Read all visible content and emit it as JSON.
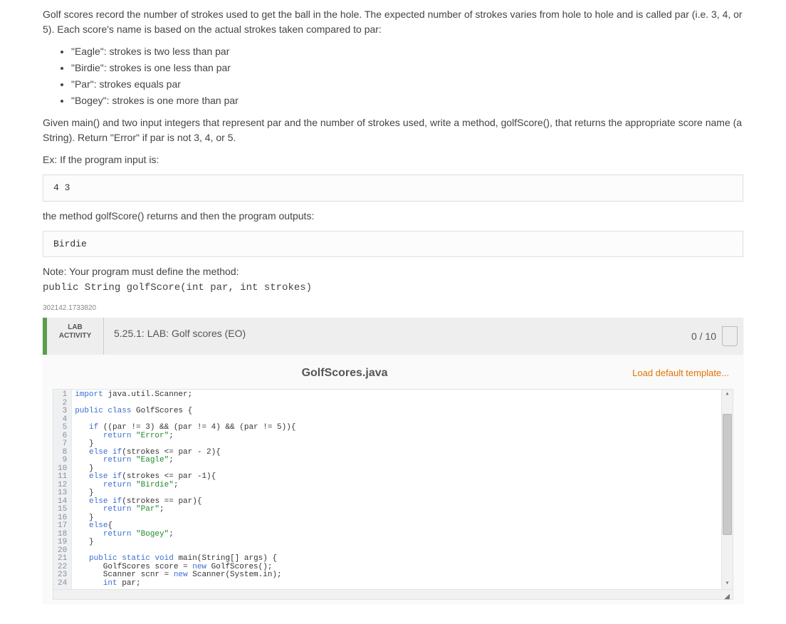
{
  "intro": {
    "paragraph1": "Golf scores record the number of strokes used to get the ball in the hole. The expected number of strokes varies from hole to hole and is called par (i.e. 3, 4, or 5). Each score's name is based on the actual strokes taken compared to par:",
    "bullets": [
      "\"Eagle\": strokes is two less than par",
      "\"Birdie\": strokes is one less than par",
      "\"Par\": strokes equals par",
      "\"Bogey\": strokes is one more than par"
    ],
    "paragraph2": "Given main() and two input integers that represent par and the number of strokes used, write a method, golfScore(), that returns the appropriate score name (a String). Return \"Error\" if par is not 3, 4, or 5.",
    "example_label": "Ex: If the program input is:",
    "example_input": "4 3",
    "output_label": "the method golfScore() returns and then the program outputs:",
    "example_output": "Birdie",
    "note_label": "Note: Your program must define the method:",
    "method_sig": "public String golfScore(int par, int strokes)",
    "ref_id": "302142.1733820"
  },
  "activity": {
    "label": "LAB\nACTIVITY",
    "title": "5.25.1: LAB: Golf scores (EO)",
    "score": "0 / 10"
  },
  "editor": {
    "filename": "GolfScores.java",
    "load_template": "Load default template...",
    "code_lines": [
      [
        [
          "kw",
          "import"
        ],
        [
          "",
          " java.util.Scanner;"
        ]
      ],
      [],
      [
        [
          "kw",
          "public"
        ],
        [
          "",
          " "
        ],
        [
          "kw",
          "class"
        ],
        [
          "",
          " GolfScores {"
        ]
      ],
      [],
      [
        [
          "",
          "   "
        ],
        [
          "kw",
          "if"
        ],
        [
          "",
          " ((par != 3) && (par != 4) && (par != 5)){"
        ]
      ],
      [
        [
          "",
          "      "
        ],
        [
          "kw",
          "return"
        ],
        [
          "",
          " "
        ],
        [
          "str",
          "\"Error\""
        ],
        [
          "",
          ";"
        ]
      ],
      [
        [
          "",
          "   }"
        ]
      ],
      [
        [
          "",
          "   "
        ],
        [
          "kw",
          "else"
        ],
        [
          "",
          " "
        ],
        [
          "kw",
          "if"
        ],
        [
          "",
          "(strokes <= par - 2){"
        ]
      ],
      [
        [
          "",
          "      "
        ],
        [
          "kw",
          "return"
        ],
        [
          "",
          " "
        ],
        [
          "str",
          "\"Eagle\""
        ],
        [
          "",
          ";"
        ]
      ],
      [
        [
          "",
          "   }"
        ]
      ],
      [
        [
          "",
          "   "
        ],
        [
          "kw",
          "else"
        ],
        [
          "",
          " "
        ],
        [
          "kw",
          "if"
        ],
        [
          "",
          "(strokes <= par -1){"
        ]
      ],
      [
        [
          "",
          "      "
        ],
        [
          "kw",
          "return"
        ],
        [
          "",
          " "
        ],
        [
          "str",
          "\"Birdie\""
        ],
        [
          "",
          ";"
        ]
      ],
      [
        [
          "",
          "   }"
        ]
      ],
      [
        [
          "",
          "   "
        ],
        [
          "kw",
          "else"
        ],
        [
          "",
          " "
        ],
        [
          "kw",
          "if"
        ],
        [
          "",
          "(strokes == par){"
        ]
      ],
      [
        [
          "",
          "      "
        ],
        [
          "kw",
          "return"
        ],
        [
          "",
          " "
        ],
        [
          "str",
          "\"Par\""
        ],
        [
          "",
          ";"
        ]
      ],
      [
        [
          "",
          "   }"
        ]
      ],
      [
        [
          "",
          "   "
        ],
        [
          "kw",
          "else"
        ],
        [
          "",
          "{"
        ]
      ],
      [
        [
          "",
          "      "
        ],
        [
          "kw",
          "return"
        ],
        [
          "",
          " "
        ],
        [
          "str",
          "\"Bogey\""
        ],
        [
          "",
          ";"
        ]
      ],
      [
        [
          "",
          "   }"
        ]
      ],
      [],
      [
        [
          "",
          "   "
        ],
        [
          "kw",
          "public"
        ],
        [
          "",
          " "
        ],
        [
          "kw",
          "static"
        ],
        [
          "",
          " "
        ],
        [
          "kw",
          "void"
        ],
        [
          "",
          " main(String[] args) {"
        ]
      ],
      [
        [
          "",
          "      GolfScores score = "
        ],
        [
          "kw",
          "new"
        ],
        [
          "",
          " GolfScores();"
        ]
      ],
      [
        [
          "",
          "      Scanner scnr = "
        ],
        [
          "kw",
          "new"
        ],
        [
          "",
          " Scanner(System.in);"
        ]
      ],
      [
        [
          "",
          "      "
        ],
        [
          "kw",
          "int"
        ],
        [
          "",
          " par;"
        ]
      ]
    ]
  }
}
